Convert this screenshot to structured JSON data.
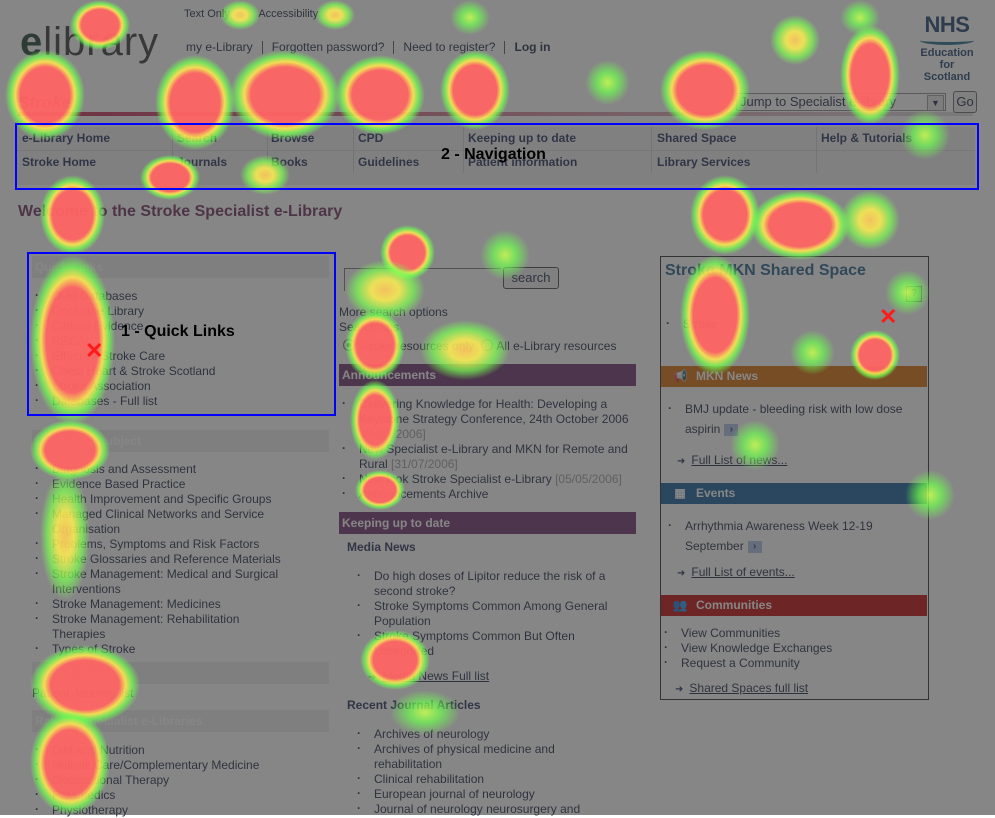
{
  "header": {
    "logo_prefix": "e",
    "logo_rest": "library",
    "top_links": [
      "Text Only",
      "Accessibility"
    ],
    "user_links": [
      "my e-Library",
      "Forgotten password?",
      "Need to register?",
      "Log in"
    ],
    "nhs_logo": {
      "big": "NHS",
      "line1": "Education",
      "line2": "for",
      "line3": "Scotland"
    },
    "section_title": "Stroke",
    "jump_select": {
      "value": "Jump to Specialist e-library"
    },
    "go_label": "Go"
  },
  "nav": {
    "annotation": "2 - Navigation",
    "row1": [
      "e-Library Home",
      "Search",
      "Browse",
      "CPD",
      "Keeping up to date",
      "Shared Space",
      "Help & Tutorials"
    ],
    "row2": [
      "Stroke Home",
      "Journals",
      "Books",
      "Guidelines",
      "Patient information",
      "Library Services",
      ""
    ]
  },
  "welcome": "Welcome to the Stroke Specialist e-Library",
  "quick_links": {
    "title": "Quick Links",
    "annotation": "1 - Quick Links",
    "items": [
      "Ovid Databases",
      "Cochrane Library",
      "Clinical Evidence",
      "RECAL",
      "Effective Stroke Care",
      "Chest Heart & Stroke Scotland",
      "Stroke Association",
      "Databases - Full list"
    ]
  },
  "browse": {
    "title": "Browse by subject",
    "items": [
      "Diagnosis and Assessment",
      "Evidence Based Practice",
      "Health Improvement and Specific Groups",
      "Managed Clinical Networks and Service Organisation",
      "Problems, Symptoms and Risk Factors",
      "Stroke Glossaries and Reference Materials",
      "Stroke Management: Medical and Surgical Interventions",
      "Stroke Management: Medicines",
      "Stroke Management: Rehabilitation Therapies",
      "Types of Stroke"
    ]
  },
  "patient_journey": {
    "title": "Patient Journey",
    "link": "Patient Journey list"
  },
  "related": {
    "title": "Related Specialist e-Libraries",
    "items": [
      "Diet and Nutrition",
      "Holistic Care/Complementary Medicine",
      "Occupational Therapy",
      "Paramedics",
      "Physiotherapy"
    ]
  },
  "search": {
    "input_value": "",
    "button": "search",
    "more_options": "More search options",
    "tips": "Search tips",
    "radio_stroke": "Stroke resources only",
    "radio_all": "All e-Library resources",
    "selected": "stroke"
  },
  "announcements": {
    "title": "Announcements",
    "items": [
      {
        "text": "Delivering Knowledge for Health: Developing a Keystone Strategy Conference, 24th October 2006",
        "date": "[26/09/2006]"
      },
      {
        "text": "New Specialist e-Library and MKN for Remote and Rural",
        "date": "[31/07/2006]"
      },
      {
        "text": "New look Stroke Specialist e-Library",
        "date": "[05/05/2006]"
      },
      {
        "text": "Announcements Archive",
        "date": ""
      }
    ]
  },
  "keeping": {
    "title": "Keeping up to date",
    "media_heading": "Media News",
    "media_items": [
      "Do high doses of Lipitor reduce the risk of a second stroke?",
      "Stroke Symptoms Common Among General Population",
      "Stroke Symptoms Common But Often Unreported"
    ],
    "media_full": "Media News Full list",
    "journal_heading": "Recent Journal Articles",
    "journal_items": [
      "Archives of neurology",
      "Archives of physical medicine and rehabilitation",
      "Clinical rehabilitation",
      "European journal of neurology",
      "Journal of neurology neurosurgery and"
    ]
  },
  "mkn": {
    "title": "Stroke MKN Shared Space",
    "help": "?",
    "spaces": [
      "Stroke"
    ],
    "news_title": "MKN News",
    "news_items": [
      "BMJ update - bleeding risk with low dose aspirin"
    ],
    "news_more": "Full List of news...",
    "events_title": "Events",
    "events_items": [
      "Arrhythmia Awareness Week 12-19 September"
    ],
    "events_more": "Full List of events...",
    "communities_title": "Communities",
    "communities_items": [
      "View Communities",
      "View Knowledge Exchanges",
      "Request a Community"
    ],
    "communities_more": "Shared Spaces full list"
  },
  "colors": {
    "panel_header": "#6b2e6b",
    "brand_red": "#b3133a",
    "news_band": "#d46a00",
    "events_band": "#0e5a9a",
    "communities_band": "#c00000",
    "annotation_box": "#0000ff"
  }
}
